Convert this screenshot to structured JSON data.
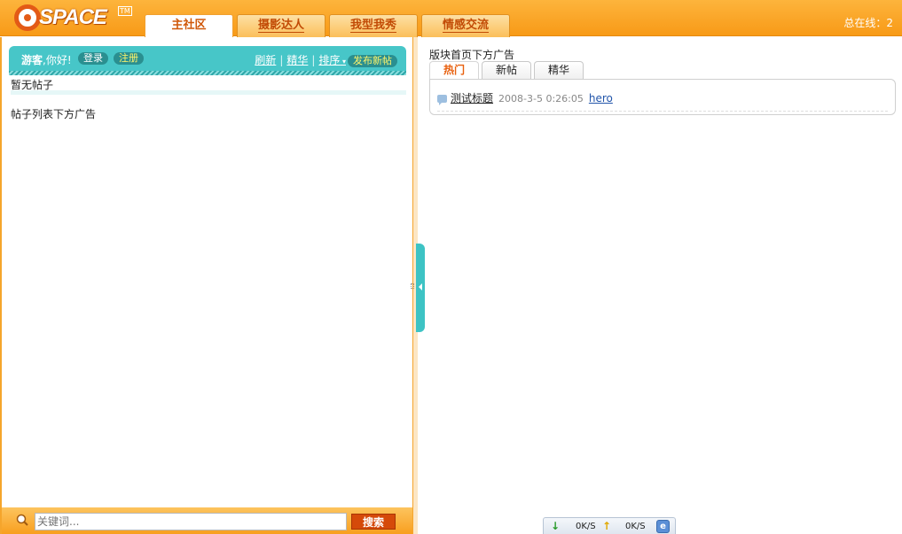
{
  "header": {
    "logo_text": "SPACE",
    "logo_tm": "TM",
    "tabs": [
      {
        "label": "主社区"
      },
      {
        "label": "摄影达人"
      },
      {
        "label": "我型我秀"
      },
      {
        "label": "情感交流"
      }
    ],
    "online_count": "总在线：2"
  },
  "left": {
    "greeting_user": "游客",
    "greeting_rest": ",你好!",
    "login_label": "登录",
    "register_label": "注册",
    "links": {
      "refresh": "刷新",
      "digest": "精华",
      "sort": "排序",
      "post_new": "发布新帖"
    },
    "empty_text": "暂无帖子",
    "bottom_ad": "帖子列表下方广告",
    "search": {
      "placeholder": "关键词...",
      "button_label": "搜索"
    }
  },
  "right": {
    "ad_text": "版块首页下方广告",
    "tabs": [
      {
        "label": "热门"
      },
      {
        "label": "新帖"
      },
      {
        "label": "精华"
      }
    ],
    "posts": [
      {
        "title": "测试标题",
        "date": "2008-3-5 0:26:05",
        "user": "hero"
      }
    ]
  },
  "speed": {
    "down": "0K/S",
    "up": "0K/S"
  },
  "colors": {
    "header_orange": "#f89a17",
    "teal": "#47c6c8",
    "tab_text": "#c24b06"
  }
}
